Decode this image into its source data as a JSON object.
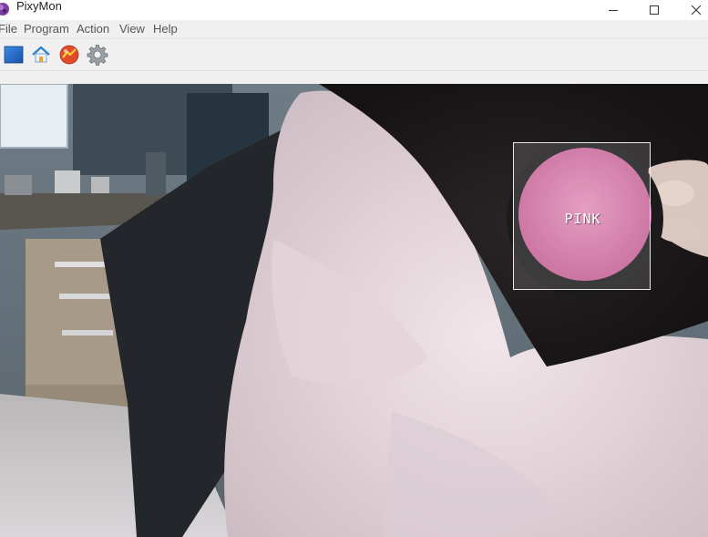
{
  "window": {
    "title": "PixyMon"
  },
  "menu": {
    "items": [
      {
        "label": "File"
      },
      {
        "label": "Program"
      },
      {
        "label": "Action"
      },
      {
        "label": "View"
      },
      {
        "label": "Help"
      }
    ]
  },
  "toolbar": {
    "buttons": [
      {
        "icon": "raw-video-icon"
      },
      {
        "icon": "home-icon"
      },
      {
        "icon": "run-signatures-icon"
      },
      {
        "icon": "gear-icon"
      }
    ]
  },
  "video": {
    "detections": [
      {
        "label": "PINK"
      }
    ]
  },
  "colors": {
    "titlebar_bg": "#ffffff",
    "menubar_bg": "#f0f0f0",
    "detection_border": "#e8e8e8",
    "detected_object": "#d77aa8"
  }
}
